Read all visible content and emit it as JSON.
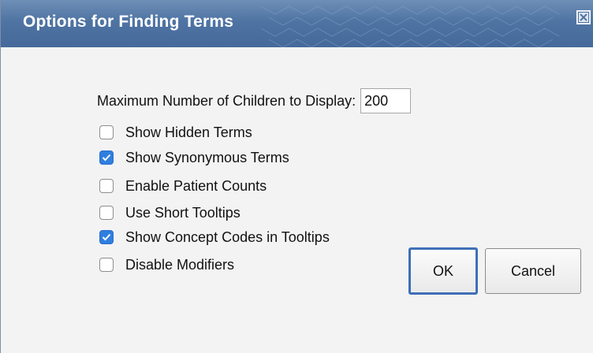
{
  "dialog": {
    "title": "Options for Finding Terms",
    "close_icon": "close-x-icon"
  },
  "max_children": {
    "label": "Maximum Number of Children to Display:",
    "value": "200"
  },
  "options": [
    {
      "label": "Show Hidden Terms",
      "checked": false
    },
    {
      "label": "Show Synonymous Terms",
      "checked": true
    },
    {
      "label": "Enable Patient Counts",
      "checked": false
    },
    {
      "label": "Use Short Tooltips",
      "checked": false
    },
    {
      "label": "Show Concept Codes in Tooltips",
      "checked": true
    },
    {
      "label": "Disable Modifiers",
      "checked": false
    }
  ],
  "buttons": {
    "ok_label": "OK",
    "cancel_label": "Cancel"
  },
  "colors": {
    "titlebar": "#4f74a3",
    "checkbox_checked": "#2f7ee0",
    "ok_focus_border": "#3e6fb8"
  }
}
